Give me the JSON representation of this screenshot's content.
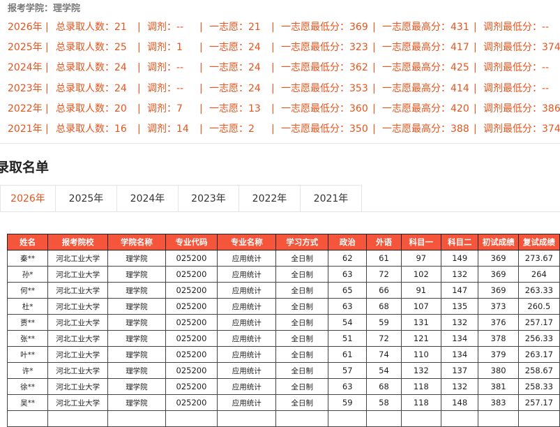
{
  "college_line": "报考学院：理学院",
  "stats": [
    {
      "year": "2026年",
      "total": "总录取人数：21",
      "adjust": "调剂：--",
      "first": "一志愿：21",
      "first_min": "一志愿最低分：369",
      "first_max": "一志愿最高分：431",
      "adjust_min": "调剂最低分：--"
    },
    {
      "year": "2025年",
      "total": "总录取人数：25",
      "adjust": "调剂：1",
      "first": "一志愿：24",
      "first_min": "一志愿最低分：323",
      "first_max": "一志愿最高分：417",
      "adjust_min": "调剂最低分：374"
    },
    {
      "year": "2024年",
      "total": "总录取人数：24",
      "adjust": "调剂：--",
      "first": "一志愿：24",
      "first_min": "一志愿最低分：362",
      "first_max": "一志愿最高分：425",
      "adjust_min": "调剂最低分：--"
    },
    {
      "year": "2023年",
      "total": "总录取人数：24",
      "adjust": "调剂：--",
      "first": "一志愿：24",
      "first_min": "一志愿最低分：353",
      "first_max": "一志愿最高分：414",
      "adjust_min": "调剂最低分：--"
    },
    {
      "year": "2022年",
      "total": "总录取人数：20",
      "adjust": "调剂：7",
      "first": "一志愿：13",
      "first_min": "一志愿最低分：360",
      "first_max": "一志愿最高分：420",
      "adjust_min": "调剂最低分：386"
    },
    {
      "year": "2021年",
      "total": "总录取人数：16",
      "adjust": "调剂：14",
      "first": "一志愿：2",
      "first_min": "一志愿最低分：350",
      "first_max": "一志愿最高分：388",
      "adjust_min": "调剂最低分：374"
    }
  ],
  "section_title": "录取名单",
  "tabs": [
    "2026年",
    "2025年",
    "2024年",
    "2023年",
    "2022年",
    "2021年"
  ],
  "active_tab": 0,
  "table": {
    "headers": [
      "姓名",
      "报考院校",
      "学院名称",
      "专业代码",
      "专业名称",
      "学习方式",
      "政治",
      "外语",
      "科目一",
      "科目二",
      "初试成绩",
      "复试成绩"
    ],
    "rows": [
      [
        "秦**",
        "河北工业大学",
        "理学院",
        "025200",
        "应用统计",
        "全日制",
        "62",
        "61",
        "97",
        "149",
        "369",
        "273.67"
      ],
      [
        "孙*",
        "河北工业大学",
        "理学院",
        "025200",
        "应用统计",
        "全日制",
        "63",
        "72",
        "102",
        "132",
        "369",
        "264"
      ],
      [
        "何**",
        "河北工业大学",
        "理学院",
        "025200",
        "应用统计",
        "全日制",
        "65",
        "66",
        "91",
        "147",
        "369",
        "263.33"
      ],
      [
        "杜*",
        "河北工业大学",
        "理学院",
        "025200",
        "应用统计",
        "全日制",
        "63",
        "68",
        "107",
        "135",
        "373",
        "260.5"
      ],
      [
        "贾**",
        "河北工业大学",
        "理学院",
        "025200",
        "应用统计",
        "全日制",
        "54",
        "59",
        "131",
        "132",
        "376",
        "257.17"
      ],
      [
        "张**",
        "河北工业大学",
        "理学院",
        "025200",
        "应用统计",
        "全日制",
        "51",
        "72",
        "121",
        "134",
        "378",
        "256.33"
      ],
      [
        "叶**",
        "河北工业大学",
        "理学院",
        "025200",
        "应用统计",
        "全日制",
        "61",
        "74",
        "110",
        "134",
        "379",
        "263.17"
      ],
      [
        "许*",
        "河北工业大学",
        "理学院",
        "025200",
        "应用统计",
        "全日制",
        "57",
        "54",
        "132",
        "137",
        "380",
        "258.67"
      ],
      [
        "徐**",
        "河北工业大学",
        "理学院",
        "025200",
        "应用统计",
        "全日制",
        "63",
        "68",
        "118",
        "132",
        "381",
        "258.33"
      ],
      [
        "吴**",
        "河北工业大学",
        "理学院",
        "025200",
        "应用统计",
        "全日制",
        "59",
        "58",
        "118",
        "148",
        "383",
        "257.17"
      ],
      [
        "",
        "",
        "",
        "",
        "",
        "",
        "",
        "",
        "",
        "",
        "",
        ""
      ]
    ]
  }
}
